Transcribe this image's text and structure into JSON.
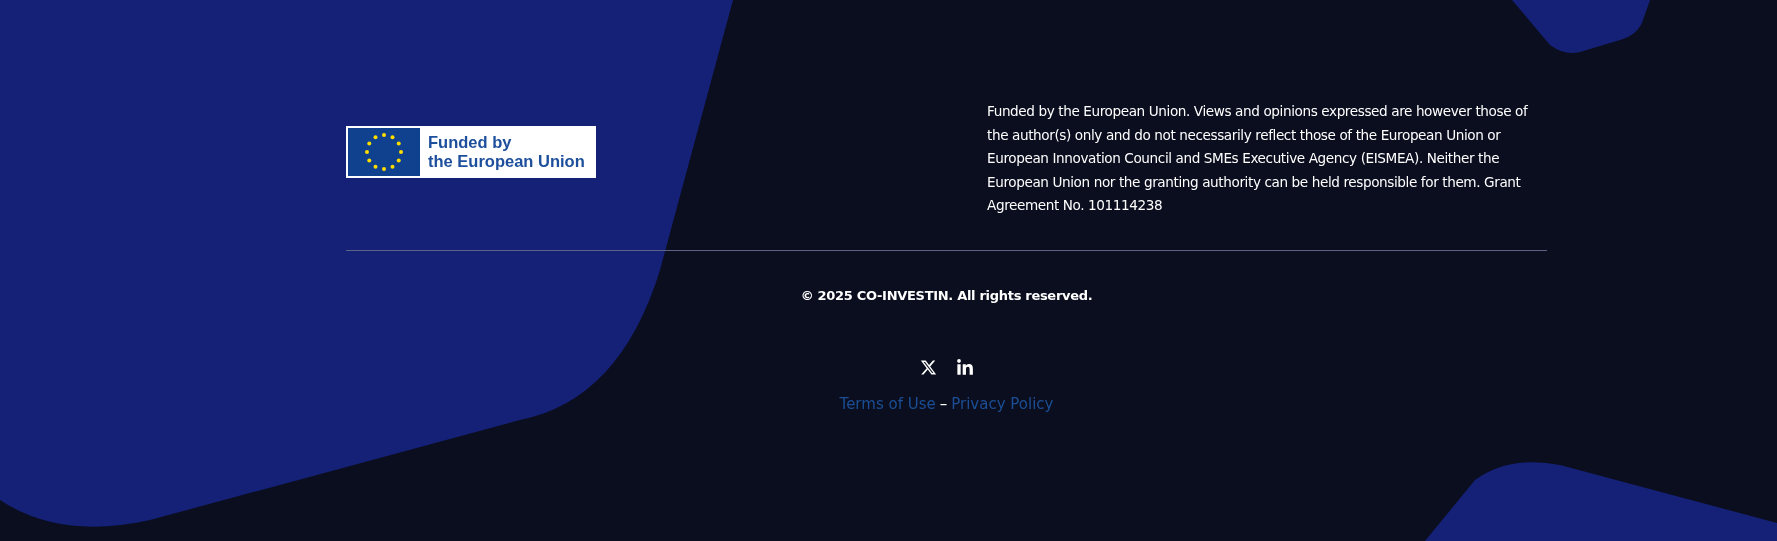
{
  "eu_logo": {
    "lines": [
      "Funded by",
      "the European Union"
    ]
  },
  "disclaimer": "Funded by the European Union. Views and opinions expressed are however those of the author(s) only and do not necessarily reflect those of the European Union or European Innovation Council and SMEs Executive Agency (EISMEA). Neither the European Union nor the granting authority can be held responsible for them. Grant Agreement No. 101114238",
  "copyright": "© 2025 CO-INVESTIN. All rights reserved.",
  "social_links": [
    {
      "kind": "x"
    },
    {
      "kind": "linkedin"
    }
  ],
  "legal_links": {
    "items": [
      "Terms of Use",
      "Privacy Policy"
    ],
    "separator": "–"
  }
}
